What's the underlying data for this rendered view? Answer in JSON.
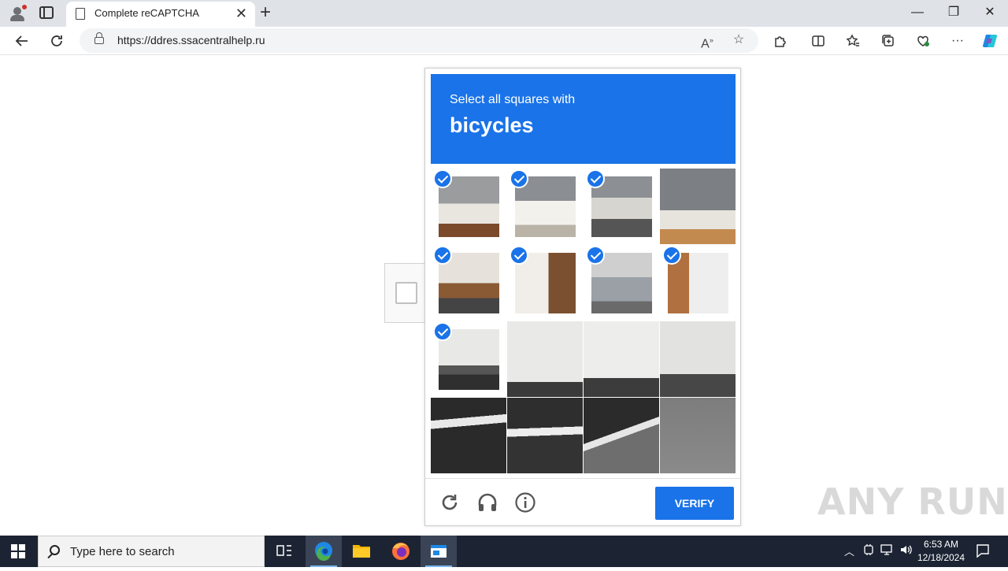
{
  "browser": {
    "tab_title": "Complete reCAPTCHA",
    "url": "https://ddres.ssacentralhelp.ru",
    "new_tab_symbol": "+",
    "tab_close_symbol": "✕",
    "window_controls": {
      "minimize": "—",
      "maximize": "❐",
      "close": "✕"
    }
  },
  "captcha": {
    "instruction": "Select all squares with",
    "target": "bicycles",
    "verify_label": "VERIFY",
    "tiles": [
      {
        "selected": true
      },
      {
        "selected": true
      },
      {
        "selected": true
      },
      {
        "selected": false
      },
      {
        "selected": true
      },
      {
        "selected": true
      },
      {
        "selected": true
      },
      {
        "selected": true
      },
      {
        "selected": true
      },
      {
        "selected": false
      },
      {
        "selected": false
      },
      {
        "selected": false
      },
      {
        "selected": false
      },
      {
        "selected": false
      },
      {
        "selected": false
      },
      {
        "selected": false
      }
    ],
    "accent_color": "#1a73e8"
  },
  "watermark": "ANY RUN",
  "taskbar": {
    "search_placeholder": "Type here to search",
    "time": "6:53 AM",
    "date": "12/18/2024"
  }
}
